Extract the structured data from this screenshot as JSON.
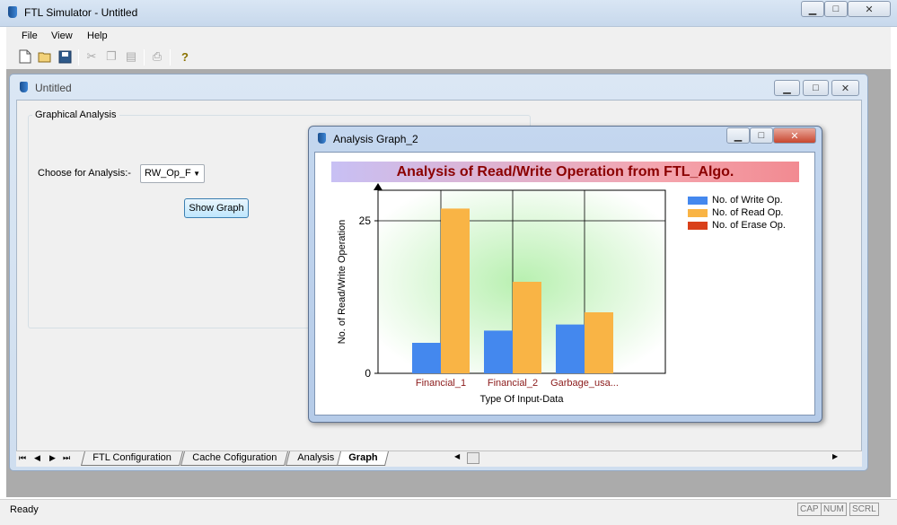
{
  "app": {
    "title": "FTL Simulator - Untitled",
    "menu": [
      "File",
      "View",
      "Help"
    ]
  },
  "child": {
    "title": "Untitled",
    "group_label": "Graphical Analysis",
    "choose_label": "Choose for Analysis:-",
    "select_value": "RW_Op_F",
    "show_graph_label": "Show Graph"
  },
  "tabs": [
    "FTL Configuration",
    "Cache Cofiguration",
    "Analysis",
    "Graph"
  ],
  "active_tab": "Graph",
  "status": {
    "text": "Ready",
    "indicators": [
      "CAP",
      "NUM",
      "SCRL"
    ]
  },
  "analysis_window": {
    "title": "Analysis Graph_2"
  },
  "chart_data": {
    "type": "bar",
    "title": "Analysis of Read/Write Operation from FTL_Algo.",
    "xlabel": "Type Of Input-Data",
    "ylabel": "No. of Read/Write Operation",
    "categories": [
      "Financial_1",
      "Financial_2",
      "Garbage_usa..."
    ],
    "yticks": [
      "0",
      "25"
    ],
    "ylim": [
      0,
      30
    ],
    "series": [
      {
        "name": "No. of Write Op.",
        "color": "#4488ee",
        "values": [
          5,
          7,
          8
        ]
      },
      {
        "name": "No. of Read Op.",
        "color": "#f9b445",
        "values": [
          27,
          15,
          10
        ]
      },
      {
        "name": "No. of Erase Op.",
        "color": "#d9401a",
        "values": [
          0,
          0,
          0
        ]
      }
    ],
    "legend": "right",
    "grid": true
  }
}
